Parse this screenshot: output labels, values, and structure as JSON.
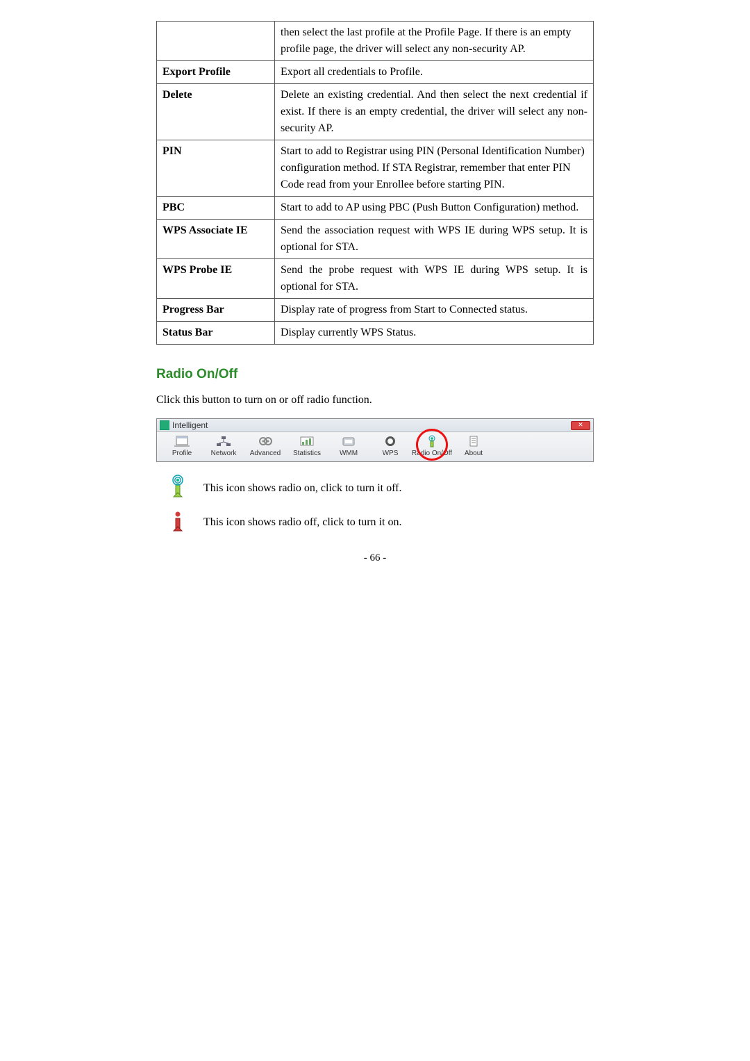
{
  "table_rows": [
    {
      "term": "",
      "desc": "then select the last profile at the Profile Page. If there is an empty profile page, the driver will select any non-security AP.",
      "justify": false
    },
    {
      "term": "Export Profile",
      "desc": "Export all credentials to Profile.",
      "justify": false
    },
    {
      "term": "Delete",
      "desc": "Delete an existing credential. And then select the next credential if exist. If there is an empty credential, the driver will select any non-security AP.",
      "justify": true
    },
    {
      "term": "PIN",
      "desc": "Start to add to Registrar using PIN (Personal Identification Number) configuration method. If STA Registrar, remember that enter PIN Code read from your Enrollee before starting PIN.",
      "justify": false
    },
    {
      "term": "PBC",
      "desc": "Start to add to AP using PBC (Push Button Configuration) method.",
      "justify": false
    },
    {
      "term": "WPS Associate IE",
      "desc": "Send the association request with WPS IE during WPS setup. It is optional for STA.",
      "justify": true
    },
    {
      "term": "WPS Probe IE",
      "desc": "Send the probe request with WPS IE during WPS setup. It is optional for STA.",
      "justify": true
    },
    {
      "term": "Progress Bar",
      "desc": "Display rate of progress from Start to Connected status.",
      "justify": false
    },
    {
      "term": "Status Bar",
      "desc": "Display currently WPS Status.",
      "justify": false
    }
  ],
  "section_heading": "Radio On/Off",
  "intro_text": "Click this button to turn on or off radio function.",
  "window": {
    "title": "Intelligent",
    "tabs": [
      {
        "id": "profile",
        "label": "Profile"
      },
      {
        "id": "network",
        "label": "Network"
      },
      {
        "id": "advanced",
        "label": "Advanced"
      },
      {
        "id": "statistics",
        "label": "Statistics"
      },
      {
        "id": "wmm",
        "label": "WMM"
      },
      {
        "id": "wps",
        "label": "WPS"
      },
      {
        "id": "radio",
        "label": "Radio On/Off"
      },
      {
        "id": "about",
        "label": "About"
      }
    ]
  },
  "icon_on_text": "This icon shows radio on, click to turn it off.",
  "icon_off_text": "This icon shows radio off, click to turn it on.",
  "page_number": "- 66 -"
}
